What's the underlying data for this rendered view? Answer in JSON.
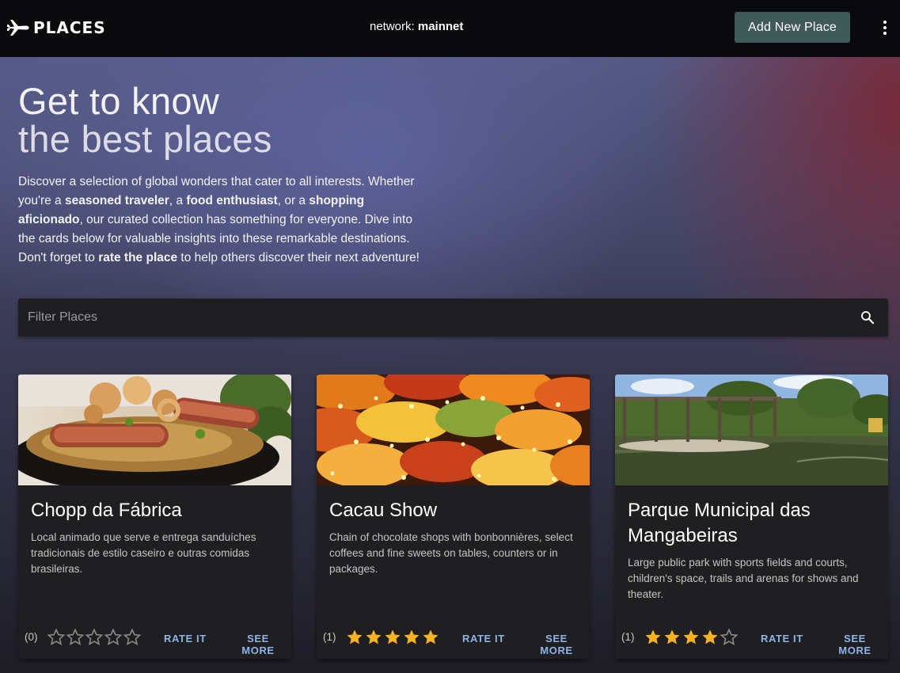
{
  "header": {
    "logo_text": "PLACES",
    "network_label": "network:",
    "network_value": "mainnet",
    "add_button": "Add New Place"
  },
  "hero": {
    "title_line1": "Get to know",
    "title_line2": "the best places",
    "intro": {
      "t1": "Discover a selection of global wonders that cater to all interests. Whether you're a ",
      "b1": "seasoned traveler",
      "t2": ", a ",
      "b2": "food enthusiast",
      "t3": ", or a ",
      "b3": "shopping aficionado",
      "t4": ", our curated collection has something for everyone. Dive into the cards below for valuable insights into these remarkable destinations. Don't forget to ",
      "b4": "rate the place",
      "t5": " to help others discover their next adventure!"
    }
  },
  "search": {
    "placeholder": "Filter Places",
    "icon": "search-icon"
  },
  "cards": [
    {
      "title": "Chopp da Fábrica",
      "description": "Local animado que serve e entrega sanduíches tradicionais de estilo caseiro e outras comidas brasileiras.",
      "rating_count": "(0)",
      "rating": 0,
      "rate_label": "RATE IT",
      "more_label": "SEE MORE"
    },
    {
      "title": "Cacau Show",
      "description": "Chain of chocolate shops with bonbonnières, select coffees and fine sweets on tables, counters or in packages.",
      "rating_count": "(1)",
      "rating": 5,
      "rate_label": "RATE IT",
      "more_label": "SEE MORE"
    },
    {
      "title": "Parque Municipal das Mangabeiras",
      "description": "Large public park with sports fields and courts, children's space, trails and arenas for shows and theater.",
      "rating_count": "(1)",
      "rating": 4,
      "rate_label": "RATE IT",
      "more_label": "SEE MORE"
    }
  ],
  "colors": {
    "accent_button": "#3f5a58",
    "link": "#8cb4e8",
    "star_filled": "#f5b225",
    "star_empty": "#8a8a8c"
  }
}
